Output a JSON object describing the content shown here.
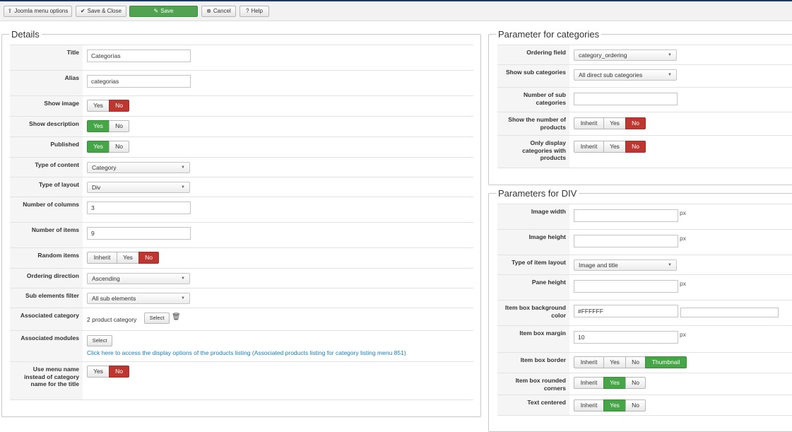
{
  "toolbar": {
    "menu_options": "Joomla menu options",
    "save_close": "Save & Close",
    "save": "Save",
    "cancel": "Cancel",
    "help": "Help"
  },
  "details": {
    "legend": "Details",
    "title_label": "Title",
    "title_value": "Categorías",
    "alias_label": "Alias",
    "alias_value": "categorias",
    "show_image_label": "Show image",
    "show_description_label": "Show description",
    "published_label": "Published",
    "type_content_label": "Type of content",
    "type_content_value": "Category",
    "type_layout_label": "Type of layout",
    "type_layout_value": "Div",
    "num_columns_label": "Number of columns",
    "num_columns_value": "3",
    "num_items_label": "Number of items",
    "num_items_value": "9",
    "random_items_label": "Random items",
    "ordering_direction_label": "Ordering direction",
    "ordering_direction_value": "Ascending",
    "sub_elements_label": "Sub elements filter",
    "sub_elements_value": "All sub elements",
    "assoc_category_label": "Associated category",
    "assoc_category_value": "2 product category",
    "assoc_modules_label": "Associated modules",
    "assoc_modules_link": "Click here to access the display options of the products listing (Associated products listing for category listing menu 851)",
    "use_menu_name_label": "Use menu name instead of category name for the title"
  },
  "buttons": {
    "yes": "Yes",
    "no": "No",
    "inherit": "Inherit",
    "select": "Select",
    "thumbnail": "Thumbnail"
  },
  "categories_params": {
    "legend": "Parameter for categories",
    "ordering_field_label": "Ordering field",
    "ordering_field_value": "category_ordering",
    "show_sub_label": "Show sub categories",
    "show_sub_value": "All direct sub categories",
    "num_sub_label": "Number of sub categories",
    "num_sub_value": "",
    "show_num_products_label": "Show the number of products",
    "only_display_label": "Only display categories with products"
  },
  "div_params": {
    "legend": "Parameters for DIV",
    "image_width_label": "Image width",
    "image_width_value": "",
    "image_height_label": "Image height",
    "image_height_value": "",
    "item_layout_label": "Type of item layout",
    "item_layout_value": "Image and title",
    "pane_height_label": "Pane height",
    "pane_height_value": "",
    "bg_color_label": "Item box background color",
    "bg_color_value": "#FFFFFF",
    "box_margin_label": "Item box margin",
    "box_margin_value": "10",
    "box_border_label": "Item box border",
    "rounded_label": "Item box rounded corners",
    "text_centered_label": "Text centered",
    "unit": "px"
  },
  "colors": {
    "active_no": "#bd362f",
    "active_yes": "#46a546",
    "save_green": "#51a351",
    "link_blue": "#1a7db5"
  }
}
